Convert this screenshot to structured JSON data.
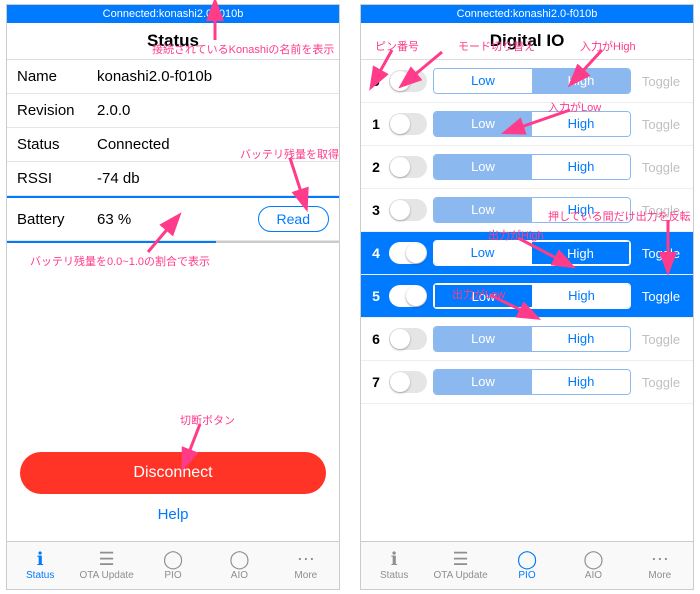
{
  "left": {
    "connected": "Connected:konashi2.0-f010b",
    "title": "Status",
    "name_label": "Name",
    "name_value": "konashi2.0-f010b",
    "revision_label": "Revision",
    "revision_value": "2.0.0",
    "status_label": "Status",
    "status_value": "Connected",
    "rssi_label": "RSSI",
    "rssi_value": "-74 db",
    "battery_label": "Battery",
    "battery_value": "63 %",
    "read_btn": "Read",
    "disconnect": "Disconnect",
    "help": "Help"
  },
  "right": {
    "connected": "Connected:konashi2.0-f010b",
    "title": "Digital IO",
    "pins": [
      {
        "num": "0",
        "mode": false,
        "sel": "high"
      },
      {
        "num": "1",
        "mode": false,
        "sel": "low"
      },
      {
        "num": "2",
        "mode": false,
        "sel": "low"
      },
      {
        "num": "3",
        "mode": false,
        "sel": "low"
      },
      {
        "num": "4",
        "mode": true,
        "sel": "high"
      },
      {
        "num": "5",
        "mode": true,
        "sel": "low"
      },
      {
        "num": "6",
        "mode": false,
        "sel": "low"
      },
      {
        "num": "7",
        "mode": false,
        "sel": "low"
      }
    ],
    "low": "Low",
    "high": "High",
    "toggle": "Toggle"
  },
  "tabs": {
    "status": "Status",
    "ota": "OTA Update",
    "pio": "PIO",
    "aio": "AIO",
    "more": "More"
  },
  "annotations": {
    "a1": "接続されているKonashiの名前を表示",
    "a2": "バッテリ残量を取得",
    "a3": "バッテリ残量を0.0~1.0の割合で表示",
    "a4": "切断ボタン",
    "a5": "ピン番号",
    "a6": "モード切り替え",
    "a7": "入力がHigh",
    "a8": "入力がLow",
    "a9": "出力がHigh",
    "a10": "出力がLow",
    "a11": "押している間だけ出力を反転"
  }
}
